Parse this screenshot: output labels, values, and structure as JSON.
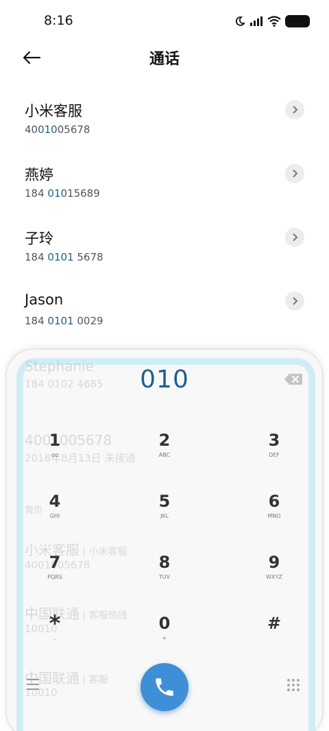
{
  "status": {
    "time": "8:16"
  },
  "header": {
    "title": "通话"
  },
  "contacts": [
    {
      "name": "小米客服",
      "num_pre": "40",
      "num_hl": "010",
      "num_post": "05678"
    },
    {
      "name": "燕婷",
      "num_pre": "184 ",
      "num_hl": "010",
      "num_post": "15689"
    },
    {
      "name": "子玲",
      "num_pre": "184 ",
      "num_hl": "0101",
      "num_post": " 5678"
    },
    {
      "name": "Jason",
      "num_pre": "184 ",
      "num_hl": "0101",
      "num_post": " 0029"
    }
  ],
  "background_items": [
    {
      "name": "Stephanie",
      "detail": "184 0102 4685"
    },
    {
      "name": "4001005678",
      "detail": "2018年8月13日 未接通"
    },
    {
      "name": "黄页",
      "detail": ""
    },
    {
      "name": "小米客服",
      "tag": "小米客服",
      "detail": "4001005678"
    },
    {
      "name": "中国联通",
      "tag": "客服热线",
      "detail": "10010"
    },
    {
      "name": "中国联通",
      "tag": "客服",
      "detail": "10010"
    }
  ],
  "dialer": {
    "display": "010",
    "keys": [
      {
        "digit": "1",
        "letters": "ᴑᴑ"
      },
      {
        "digit": "2",
        "letters": "ABC"
      },
      {
        "digit": "3",
        "letters": "DEF"
      },
      {
        "digit": "4",
        "letters": "GHI"
      },
      {
        "digit": "5",
        "letters": "JKL"
      },
      {
        "digit": "6",
        "letters": "MNO"
      },
      {
        "digit": "7",
        "letters": "PQRS"
      },
      {
        "digit": "8",
        "letters": "TUV"
      },
      {
        "digit": "9",
        "letters": "WXYZ"
      },
      {
        "digit": "*",
        "letters": ","
      },
      {
        "digit": "0",
        "letters": "+"
      },
      {
        "digit": "#",
        "letters": ""
      }
    ]
  },
  "icons": {
    "back": "back-arrow-icon",
    "chevron": "chevron-right-icon",
    "delete": "backspace-icon",
    "call": "phone-icon",
    "menu": "menu-icon",
    "dialpad": "dialpad-icon",
    "moon": "moon-icon",
    "signal": "signal-icon",
    "wifi": "wifi-icon",
    "battery": "battery-icon"
  },
  "colors": {
    "accent": "#1f5f8f",
    "call_button": "#3f8fd6",
    "dialer_border": "#cfeef4"
  }
}
